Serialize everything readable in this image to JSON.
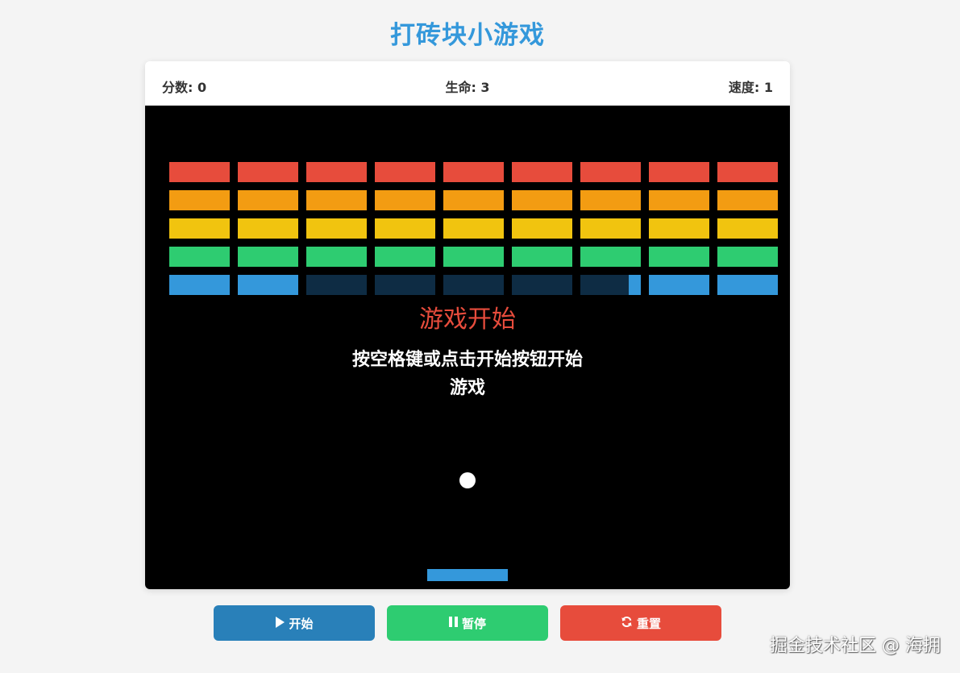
{
  "title": "打砖块小游戏",
  "status": {
    "score": "分数: 0",
    "lives": "生命: 3",
    "speed": "速度: 1"
  },
  "game": {
    "overlay_title": "游戏开始",
    "overlay_message": "按空格键或点击开始按钮开始游戏",
    "colors": {
      "background": "#000000",
      "ball": "#ffffff",
      "paddle": "#3498db",
      "brick_rows": [
        "#e74c3c",
        "#f39c12",
        "#f1c40f",
        "#2ecc71",
        "#3498db"
      ],
      "dimmed_brick": "#0e2c44"
    },
    "brick_grid": {
      "rows": 5,
      "columns": 9,
      "dimmed_cells": [
        [
          4,
          2
        ],
        [
          4,
          3
        ],
        [
          4,
          4
        ],
        [
          4,
          5
        ],
        [
          4,
          6
        ]
      ]
    }
  },
  "controls": {
    "start_label": "开始",
    "start_icon": "play-icon",
    "pause_label": "暂停",
    "pause_icon": "pause-icon",
    "reset_label": "重置",
    "reset_icon": "refresh-icon",
    "colors": {
      "start": "#2980b9",
      "pause": "#2ecc71",
      "reset": "#e74c3c"
    }
  },
  "watermark": "掘金技术社区 @ 海拥"
}
